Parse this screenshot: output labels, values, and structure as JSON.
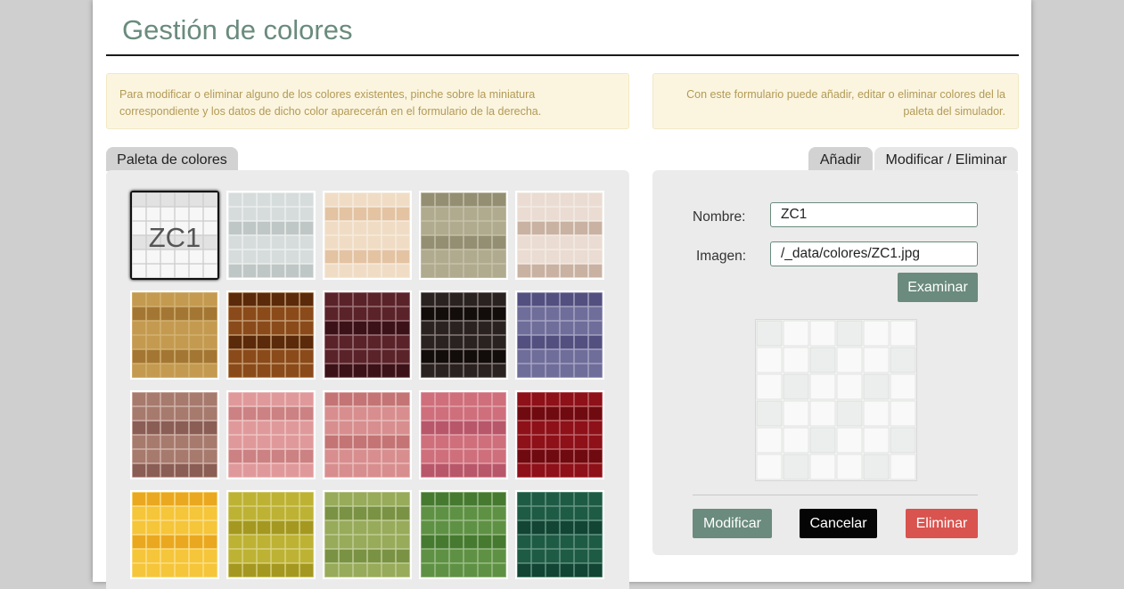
{
  "header": {
    "title": "Gestión de colores"
  },
  "notes": {
    "left": "Para modificar o eliminar alguno de los colores existentes, pinche sobre la miniatura correspondiente y los datos de dicho color aparecerán en el formulario de la derecha.",
    "right": "Con este formulario puede añadir, editar o eliminar colores del la paleta del simulador."
  },
  "palette": {
    "tab_label": "Paleta de colores",
    "selected_label": "ZC1",
    "swatches": [
      {
        "c1": "#f7f7f7",
        "c2": "#e2e2e2",
        "grout": "#cfcfcf"
      },
      {
        "c1": "#d6dcdc",
        "c2": "#bfc7c6",
        "grout": "#eef0ef"
      },
      {
        "c1": "#f0dcc4",
        "c2": "#e3c3a2",
        "grout": "#f6ece0"
      },
      {
        "c1": "#b0ab8e",
        "c2": "#948f72",
        "grout": "#c7c3ae"
      },
      {
        "c1": "#eadcd2",
        "c2": "#c9b2a2",
        "grout": "#f3ece6"
      },
      {
        "c1": "#c39a4f",
        "c2": "#a37733",
        "grout": "#d6b376"
      },
      {
        "c1": "#8a4a19",
        "c2": "#5a2a0a",
        "grout": "#c9a27a"
      },
      {
        "c1": "#5a2329",
        "c2": "#3a1217",
        "grout": "#a47b80"
      },
      {
        "c1": "#2a2220",
        "c2": "#120c0b",
        "grout": "#8d8582"
      },
      {
        "c1": "#6f6d9a",
        "c2": "#535080",
        "grout": "#a9a8c6"
      },
      {
        "c1": "#a77a6e",
        "c2": "#8a5e55",
        "grout": "#d3b7ae"
      },
      {
        "c1": "#e0999a",
        "c2": "#cc8182",
        "grout": "#f0c9c9"
      },
      {
        "c1": "#d88e8e",
        "c2": "#c47474",
        "grout": "#ebc1c1"
      },
      {
        "c1": "#cf6f7c",
        "c2": "#b8576a",
        "grout": "#e6aab2"
      },
      {
        "c1": "#8e1018",
        "c2": "#6e0a10",
        "grout": "#c26a70"
      },
      {
        "c1": "#f5c53a",
        "c2": "#eaa820",
        "grout": "#fbe08a"
      },
      {
        "c1": "#bdb233",
        "c2": "#a49821",
        "grout": "#dbd586"
      },
      {
        "c1": "#97ab5a",
        "c2": "#7a9244",
        "grout": "#c4d09a"
      },
      {
        "c1": "#5f9144",
        "c2": "#467a30",
        "grout": "#9fc08c"
      },
      {
        "c1": "#1e5b45",
        "c2": "#124533",
        "grout": "#6a9988"
      }
    ]
  },
  "form": {
    "tabs": [
      {
        "label": "Añadir"
      },
      {
        "label": "Modificar / Eliminar"
      }
    ],
    "name_label": "Nombre:",
    "name_value": "ZC1",
    "image_label": "Imagen:",
    "image_value": "/_data/colores/ZC1.jpg",
    "browse_label": "Examinar",
    "modify_label": "Modificar",
    "cancel_label": "Cancelar",
    "delete_label": "Eliminar"
  }
}
